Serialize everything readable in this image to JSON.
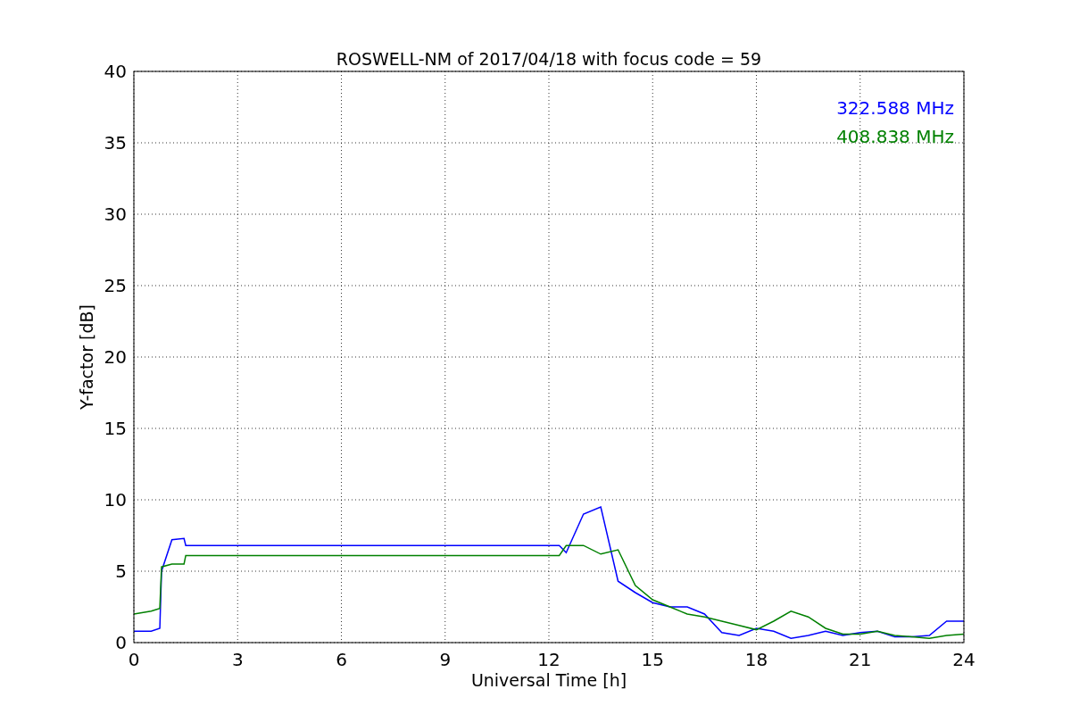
{
  "figure": {
    "chart_data": {
      "type": "line",
      "title": "ROSWELL-NM of 2017/04/18 with focus code = 59",
      "xlabel": "Universal Time [h]",
      "ylabel": "Y-factor [dB]",
      "grid": true,
      "x": [
        0,
        0.5,
        0.75,
        0.8,
        1.1,
        1.45,
        1.5,
        3,
        6,
        9,
        12.3,
        12.5,
        13,
        13.5,
        14,
        14.5,
        15,
        15.5,
        16,
        16.5,
        17,
        17.5,
        18,
        18.5,
        19,
        19.5,
        20,
        20.5,
        21,
        21.5,
        22,
        22.5,
        23,
        23.5,
        24
      ],
      "series": [
        {
          "name": "322.588 MHz",
          "color": "#0000ff",
          "values": [
            0.8,
            0.8,
            1.0,
            5,
            7.2,
            7.3,
            6.8,
            6.8,
            6.8,
            6.8,
            6.8,
            6.3,
            9,
            9.5,
            4.3,
            3.5,
            2.8,
            2.5,
            2.5,
            2.0,
            0.7,
            0.5,
            1.0,
            0.8,
            0.3,
            0.5,
            0.8,
            0.5,
            0.7,
            0.8,
            0.4,
            0.4,
            0.5,
            1.5,
            1.5
          ]
        },
        {
          "name": "408.838 MHz",
          "color": "#008000",
          "values": [
            2.0,
            2.2,
            2.4,
            5.3,
            5.5,
            5.5,
            6.1,
            6.1,
            6.1,
            6.1,
            6.1,
            6.8,
            6.8,
            6.2,
            6.5,
            4.0,
            3.0,
            2.5,
            2.0,
            1.8,
            1.5,
            1.2,
            0.9,
            1.5,
            2.2,
            1.8,
            1.0,
            0.6,
            0.6,
            0.8,
            0.5,
            0.4,
            0.3,
            0.5,
            0.6
          ]
        }
      ],
      "xlim": [
        0,
        24
      ],
      "ylim": [
        0,
        40
      ],
      "xticks": [
        0,
        3,
        6,
        9,
        12,
        15,
        18,
        21,
        24
      ],
      "yticks": [
        0,
        5,
        10,
        15,
        20,
        25,
        30,
        35,
        40
      ]
    }
  }
}
